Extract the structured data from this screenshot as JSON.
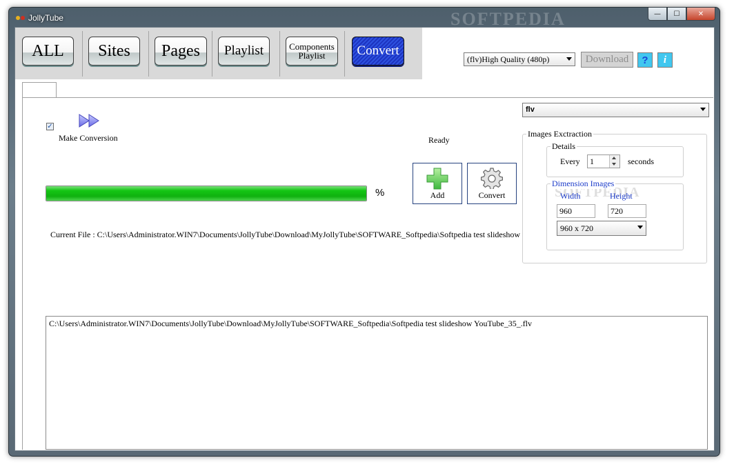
{
  "window": {
    "title": "JollyTube",
    "watermark": "SOFTPEDIA",
    "minimize_glyph": "—",
    "maximize_glyph": "☐",
    "close_glyph": "✕"
  },
  "top_tabs": [
    {
      "label": "ALL"
    },
    {
      "label": "Sites"
    },
    {
      "label": "Pages"
    },
    {
      "label": "Playlist"
    },
    {
      "label_line1": "Components",
      "label_line2": "Playlist"
    },
    {
      "label": "Convert"
    }
  ],
  "toolbar": {
    "quality_selected": "(flv)High Quality (480p)",
    "download_label": "Download",
    "help_label": "?",
    "info_label": "i"
  },
  "conversion": {
    "make_conversion_label": "Make Conversion",
    "make_conversion_checked": true,
    "check_glyph": "✓",
    "status": "Ready",
    "progress_percent": 100,
    "percent_sign": "%",
    "add_label": "Add",
    "convert_label": "Convert",
    "current_file": "Current File : C:\\Users\\Administrator.WIN7\\Documents\\JollyTube\\Download\\MyJollyTube\\SOFTWARE_Softpedia\\Softpedia test slideshow",
    "log_lines": [
      "C:\\Users\\Administrator.WIN7\\Documents\\JollyTube\\Download\\MyJollyTube\\SOFTWARE_Softpedia\\Softpedia test slideshow YouTube_35_.flv"
    ]
  },
  "settings": {
    "format_selected": "flv",
    "images_extraction_title": "Images Exctraction",
    "details_title": "Details",
    "every_label": "Every",
    "every_value": "1",
    "seconds_label": "seconds",
    "dimension_title": "Dimension Images",
    "width_label": "Width",
    "height_label": "Height",
    "width_value": "960",
    "height_value": "720",
    "size_selected": "960 x 720",
    "watermark": "SOFTPEDIA"
  },
  "colors": {
    "progress_green": "#15c615",
    "active_tab_blue": "#2d52e0",
    "help_cyan": "#41c7ef",
    "link_blue": "#1a3ac9"
  }
}
